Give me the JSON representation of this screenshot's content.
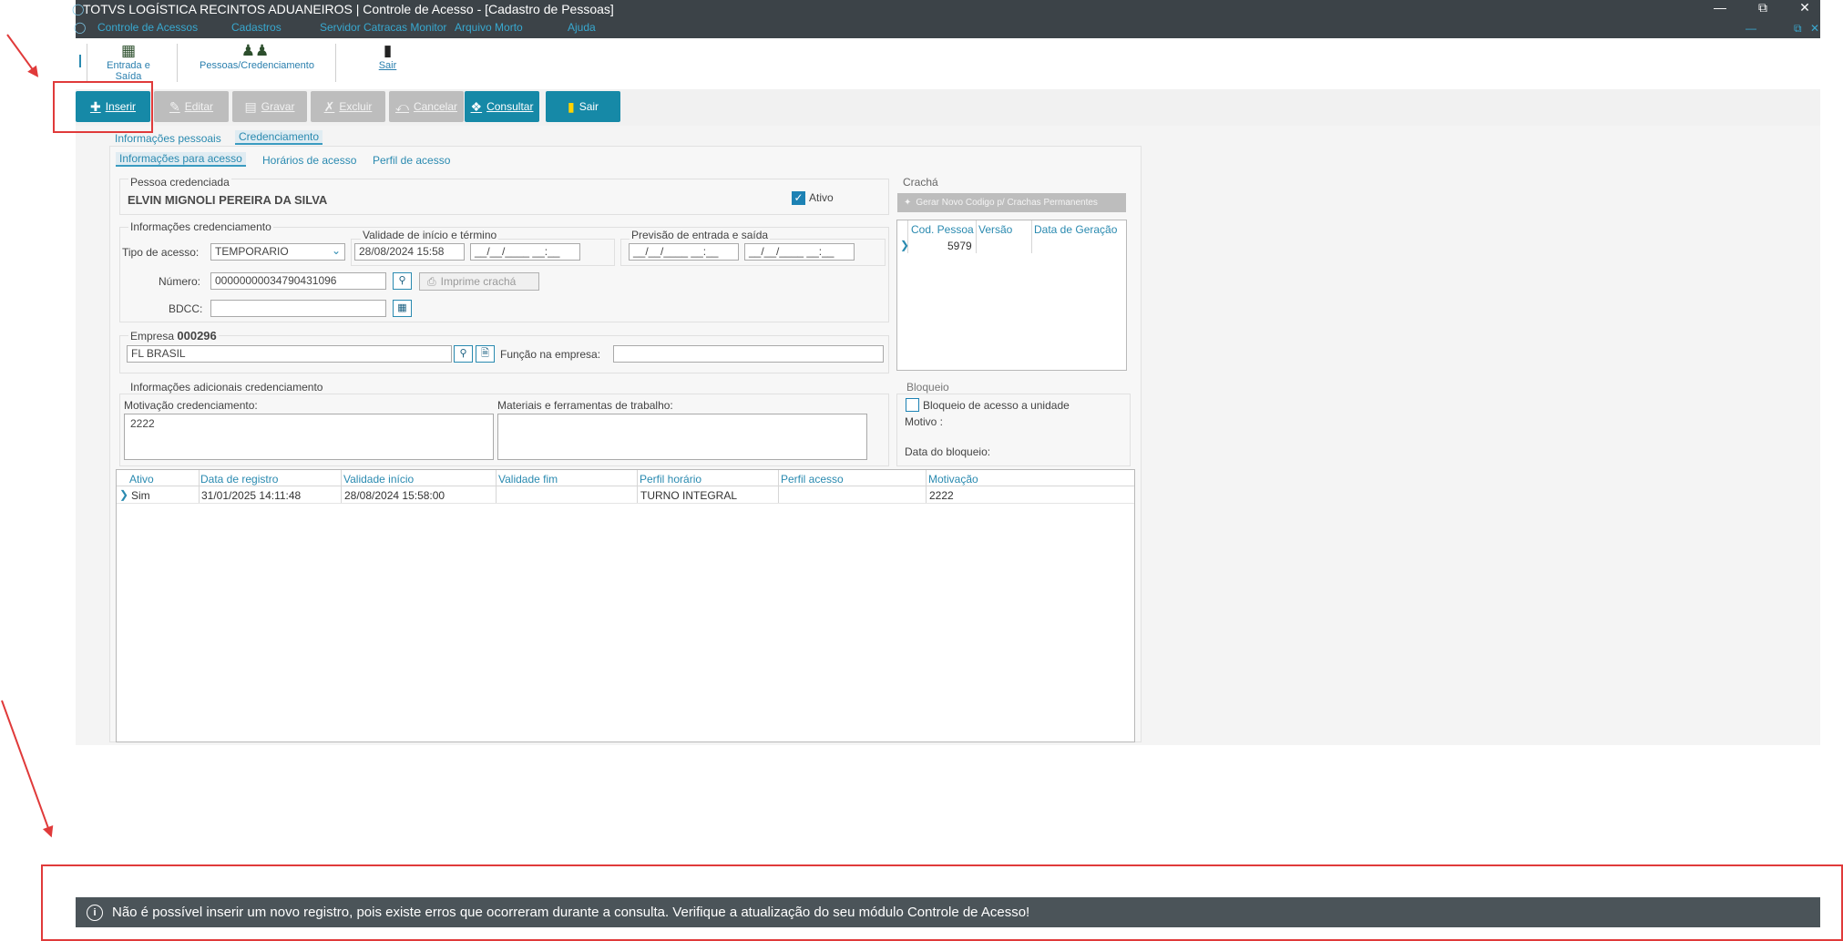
{
  "window": {
    "title": "TOTVS LOGÍSTICA RECINTOS ADUANEIROS | Controle de Acesso - [Cadastro de Pessoas]",
    "menus": [
      "Controle de Acessos",
      "Cadastros",
      "Servidor Catracas Monitor",
      "Arquivo Morto",
      "Ajuda"
    ]
  },
  "toolbar": {
    "entrada_saida": "Entrada e Saída",
    "pessoas_credenciamento": "Pessoas/Credenciamento",
    "sair": "Sair"
  },
  "actions": {
    "inserir": "Inserir",
    "editar": "Editar",
    "gravar": "Gravar",
    "excluir": "Excluir",
    "cancelar": "Cancelar",
    "consultar": "Consultar",
    "sair": "Sair"
  },
  "tabs": {
    "info_pessoais": "Informações pessoais",
    "credenciamento": "Credenciamento",
    "info_acesso": "Informações para acesso",
    "horarios": "Horários de acesso",
    "perfil": "Perfil de acesso"
  },
  "pessoa": {
    "label": "Pessoa credenciada",
    "nome": "ELVIN MIGNOLI PEREIRA DA SILVA",
    "ativo_label": "Ativo",
    "ativo": true
  },
  "credenciamento": {
    "group_label": "Informações credenciamento",
    "tipo_label": "Tipo de acesso:",
    "tipo_value": "TEMPORARIO",
    "validade_label": "Validade de início e término",
    "validade_inicio": "28/08/2024 15:58",
    "validade_fim": "__/__/____ __:__",
    "previsao_label": "Previsão de entrada e saída",
    "previsao_entrada": "__/__/____ __:__",
    "previsao_saida": "__/__/____ __:__",
    "numero_label": "Número:",
    "numero_value": "00000000034790431096",
    "imprime_label": "Imprime crachá",
    "bdcc_label": "BDCC:",
    "bdcc_value": ""
  },
  "empresa": {
    "label": "Empresa",
    "codigo": "000296",
    "nome": "FL BRASIL",
    "funcao_label": "Função na empresa:",
    "funcao_value": ""
  },
  "adicionais": {
    "group_label": "Informações adicionais credenciamento",
    "motivacao_label": "Motivação credenciamento:",
    "motivacao_value": "2222",
    "materiais_label": "Materiais e ferramentas de trabalho:",
    "materiais_value": ""
  },
  "cracha": {
    "label": "Crachá",
    "gerar_button": "Gerar Novo Codigo p/ Crachas Permanentes",
    "columns": [
      "Cod. Pessoa",
      "Versão",
      "Data de Geração"
    ],
    "rows": [
      [
        "5979",
        "",
        ""
      ]
    ]
  },
  "bloqueio": {
    "label": "Bloqueio",
    "checkbox_label": "Bloqueio de acesso a unidade",
    "motivo_label": "Motivo :",
    "data_label": "Data do bloqueio:"
  },
  "historico": {
    "columns": [
      "Ativo",
      "Data de registro",
      "Validade início",
      "Validade fim",
      "Perfil horário",
      "Perfil acesso",
      "Motivação"
    ],
    "rows": [
      [
        "Sim",
        "31/01/2025 14:11:48",
        "28/08/2024 15:58:00",
        "",
        "TURNO INTEGRAL",
        "",
        "2222"
      ]
    ]
  },
  "notification": {
    "message": "Não é possível inserir um novo registro, pois existe erros que ocorreram durante a consulta. Verifique a atualização do seu módulo Controle de Acesso!"
  },
  "colors": {
    "accent": "#1689a7",
    "titlebar": "#3c4348",
    "notification_bg": "#4b5459",
    "annotation_red": "#e03a3a"
  }
}
